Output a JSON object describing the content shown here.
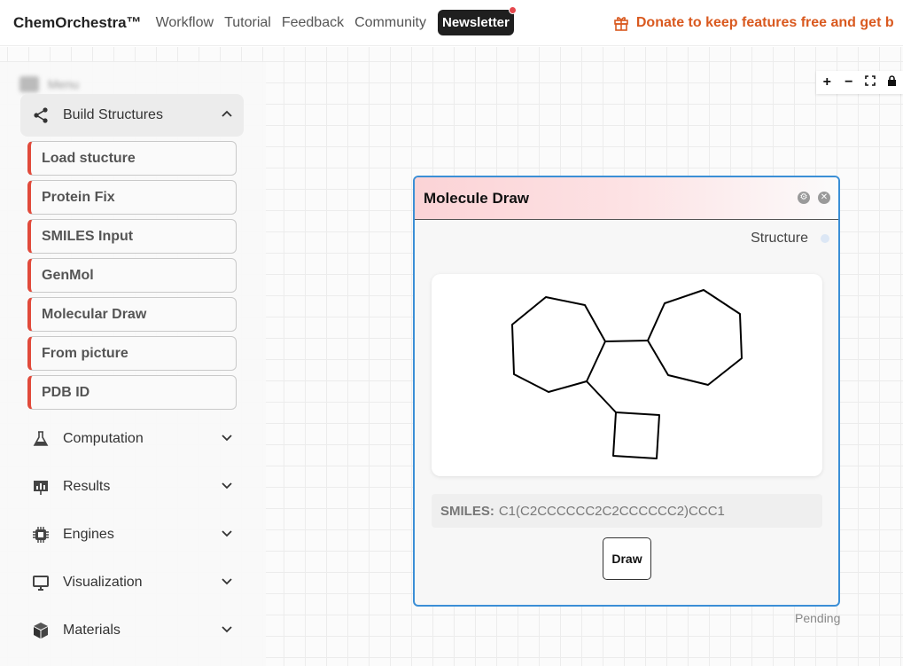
{
  "app": {
    "brand": "ChemOrchestra™",
    "nav": [
      "Workflow",
      "Tutorial",
      "Feedback",
      "Community"
    ],
    "newsletter": "Newsletter",
    "donate": "Donate to keep features free and get b"
  },
  "colors": {
    "accent_red": "#e14a3b",
    "node_border": "#3b8fd6",
    "donate_orange": "#d9591f"
  },
  "zoom": [
    "+",
    "−",
    "⛶",
    "🔒"
  ],
  "sidebar": {
    "header_label": "Menu",
    "open_section": {
      "label": "Build Structures",
      "icon": "share-icon"
    },
    "items": [
      "Load stucture",
      "Protein Fix",
      "SMILES Input",
      "GenMol",
      "Molecular Draw",
      "From picture",
      "PDB ID"
    ],
    "sections": [
      {
        "label": "Computation",
        "icon": "flask-icon"
      },
      {
        "label": "Results",
        "icon": "chart-icon"
      },
      {
        "label": "Engines",
        "icon": "chip-icon"
      },
      {
        "label": "Visualization",
        "icon": "monitor-icon"
      },
      {
        "label": "Materials",
        "icon": "cube-icon"
      }
    ]
  },
  "node": {
    "title": "Molecule Draw",
    "output_label": "Structure",
    "smiles_label": "SMILES:",
    "smiles_value": "C1(C2CCCCCC2C2CCCCCC2)CCC1",
    "draw_button": "Draw",
    "status": "Pending"
  }
}
